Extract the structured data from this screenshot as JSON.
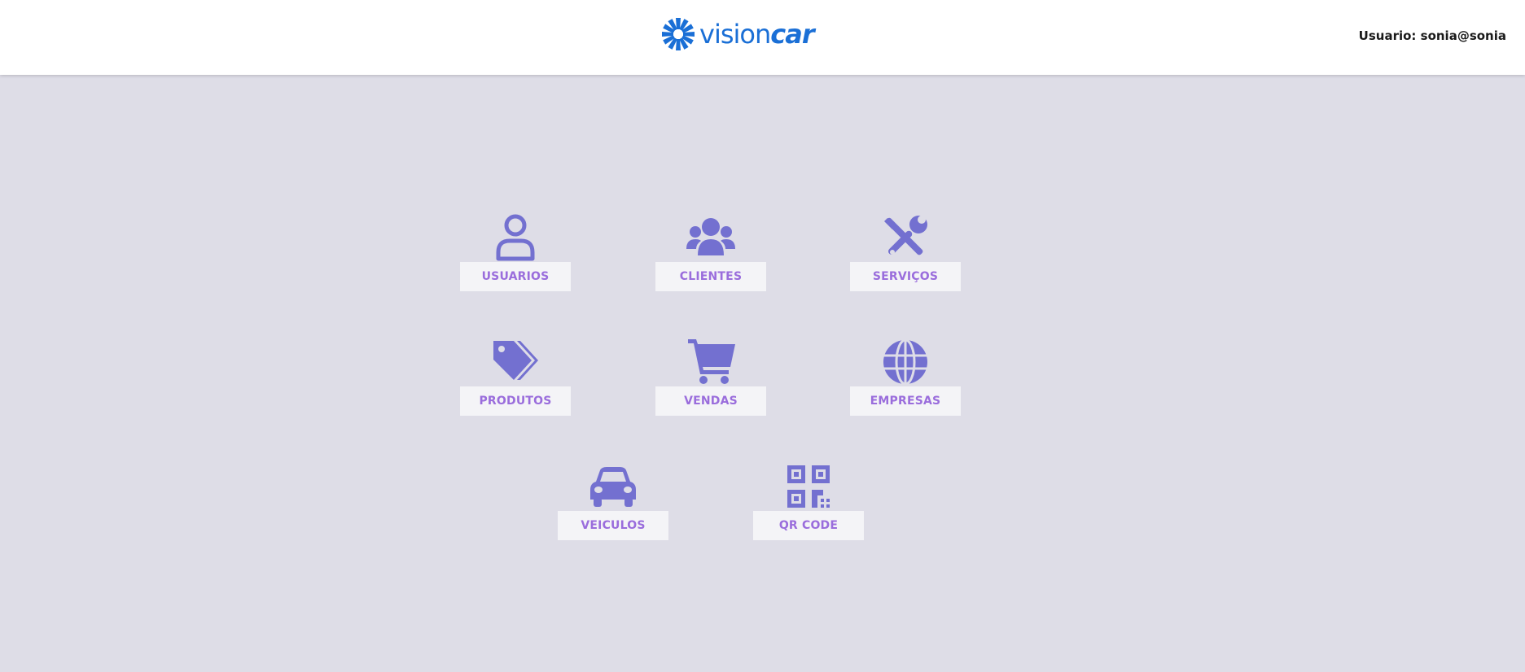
{
  "header": {
    "logo_text_light": "vision",
    "logo_text_bold": "car",
    "user_label": "Usuario: sonia@sonia"
  },
  "colors": {
    "icon": "#7370d0",
    "label_text": "#9a6ddc",
    "label_bg": "#f4f4f7",
    "background": "#dedde7",
    "brand": "#1a6fd6"
  },
  "menu": {
    "usuarios": {
      "label": "USUARIOS",
      "icon": "user-icon"
    },
    "clientes": {
      "label": "CLIENTES",
      "icon": "users-group-icon"
    },
    "servicos": {
      "label": "SERVIÇOS",
      "icon": "tools-icon"
    },
    "produtos": {
      "label": "PRODUTOS",
      "icon": "tags-icon"
    },
    "vendas": {
      "label": "VENDAS",
      "icon": "shopping-cart-icon"
    },
    "empresas": {
      "label": "EMPRESAS",
      "icon": "globe-icon"
    },
    "veiculos": {
      "label": "VEICULOS",
      "icon": "car-icon"
    },
    "qrcode": {
      "label": "QR CODE",
      "icon": "qrcode-icon"
    }
  }
}
